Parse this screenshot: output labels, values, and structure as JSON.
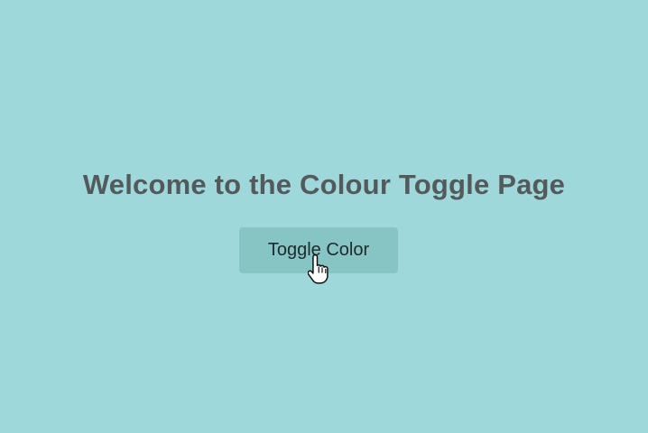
{
  "page": {
    "title": "Welcome to the Colour Toggle Page",
    "button_label": "Toggle Color"
  },
  "colors": {
    "background": "#9fd8da",
    "button": "#87c4c4",
    "title_text": "#545a5b",
    "button_text": "#1e2a2b"
  },
  "icons": {
    "cursor": "hand-pointer-cursor-icon"
  }
}
